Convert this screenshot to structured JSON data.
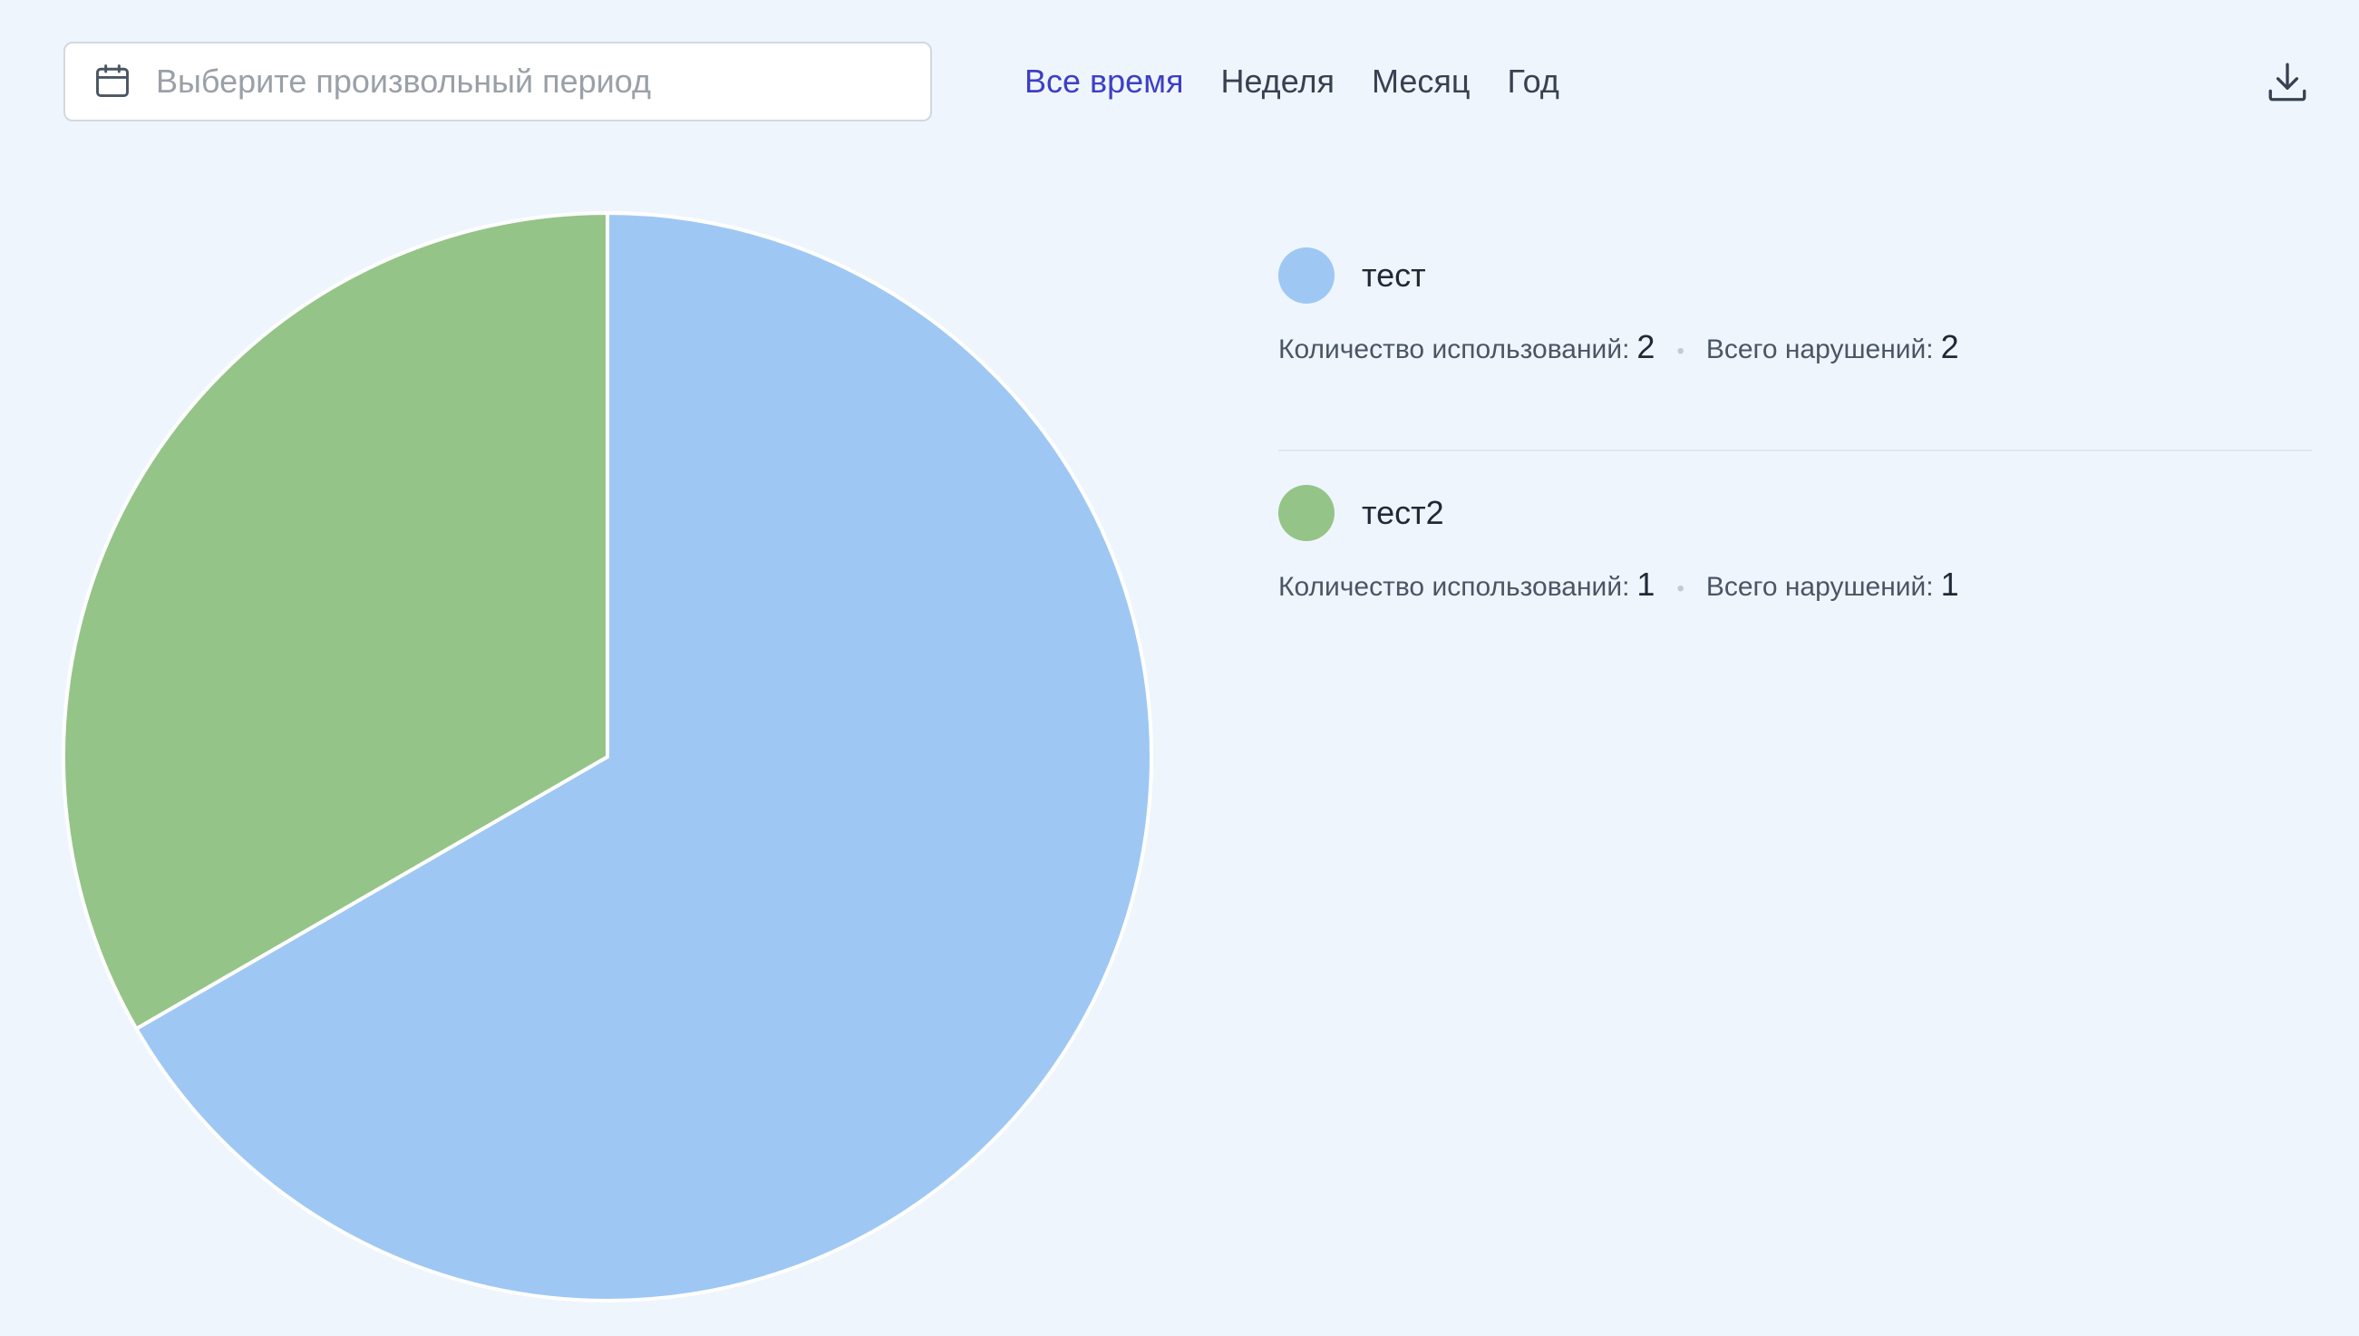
{
  "filter": {
    "placeholder": "Выберите произвольный период",
    "icon": "calendar-icon"
  },
  "periods": [
    {
      "label": "Все время",
      "active": true
    },
    {
      "label": "Неделя",
      "active": false
    },
    {
      "label": "Месяц",
      "active": false
    },
    {
      "label": "Год",
      "active": false
    }
  ],
  "download_icon": "download-icon",
  "colors": {
    "active_period": "#3d3fc4",
    "series": [
      "#9ec8f3",
      "#94c487"
    ]
  },
  "legend": {
    "usage_label": "Количество использований:",
    "violations_label": "Всего нарушений:",
    "items": [
      {
        "name": "тест",
        "usage": "2",
        "violations": "2"
      },
      {
        "name": "тест2",
        "usage": "1",
        "violations": "1"
      }
    ]
  },
  "chart_data": {
    "type": "pie",
    "categories": [
      "тест",
      "тест2"
    ],
    "values": [
      2,
      1
    ],
    "colors": [
      "#9ec8f3",
      "#94c487"
    ],
    "legend_position": "right"
  }
}
